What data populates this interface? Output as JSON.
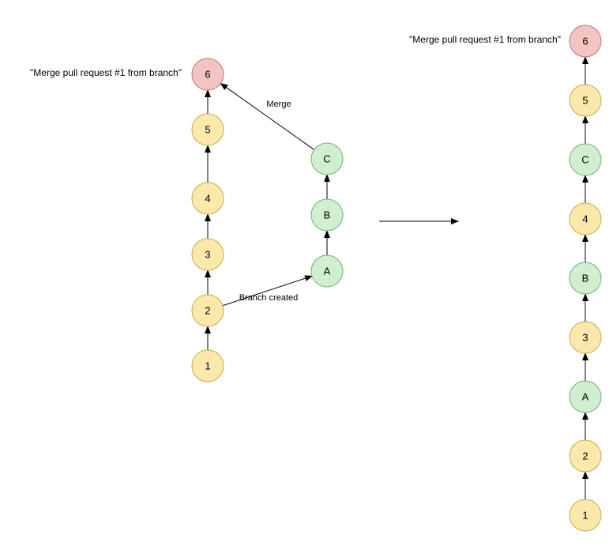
{
  "colors": {
    "yellow_fill": "#fae9ab",
    "yellow_stroke": "#c9a94a",
    "green_fill": "#d1eed1",
    "green_stroke": "#6fb36f",
    "red_fill": "#f2c4c2",
    "red_stroke": "#c27572",
    "arrow": "#000000"
  },
  "left": {
    "caption": "\"Merge pull request #1 from branch\"",
    "main": [
      {
        "label": "1",
        "color": "yellow"
      },
      {
        "label": "2",
        "color": "yellow"
      },
      {
        "label": "3",
        "color": "yellow"
      },
      {
        "label": "4",
        "color": "yellow"
      },
      {
        "label": "5",
        "color": "yellow"
      },
      {
        "label": "6",
        "color": "red"
      }
    ],
    "branch": [
      {
        "label": "A",
        "color": "green"
      },
      {
        "label": "B",
        "color": "green"
      },
      {
        "label": "C",
        "color": "green"
      }
    ],
    "edge_branch_created": "Branch created",
    "edge_merge": "Merge"
  },
  "right": {
    "caption": "\"Merge pull request #1 from branch\"",
    "sequence": [
      {
        "label": "1",
        "color": "yellow"
      },
      {
        "label": "2",
        "color": "yellow"
      },
      {
        "label": "A",
        "color": "green"
      },
      {
        "label": "3",
        "color": "yellow"
      },
      {
        "label": "B",
        "color": "green"
      },
      {
        "label": "4",
        "color": "yellow"
      },
      {
        "label": "C",
        "color": "green"
      },
      {
        "label": "5",
        "color": "yellow"
      },
      {
        "label": "6",
        "color": "red"
      }
    ]
  },
  "chart_data": {
    "type": "diagram",
    "description": "Git branch merge diagram showing before (branched) and after (linearized) commit histories",
    "left_graph": {
      "main_chain": [
        "1",
        "2",
        "3",
        "4",
        "5",
        "6"
      ],
      "branch_chain": [
        "A",
        "B",
        "C"
      ],
      "edges": [
        [
          "1",
          "2"
        ],
        [
          "2",
          "3"
        ],
        [
          "3",
          "4"
        ],
        [
          "4",
          "5"
        ],
        [
          "5",
          "6"
        ],
        [
          "2",
          "A"
        ],
        [
          "A",
          "B"
        ],
        [
          "B",
          "C"
        ],
        [
          "C",
          "6"
        ]
      ],
      "edge_labels": {
        "2-A": "Branch created",
        "C-6": "Merge"
      },
      "merge_commit": "6",
      "caption": "\"Merge pull request #1 from branch\""
    },
    "right_graph": {
      "linear_chain": [
        "1",
        "2",
        "A",
        "3",
        "B",
        "4",
        "C",
        "5",
        "6"
      ],
      "merge_commit": "6",
      "caption": "\"Merge pull request #1 from branch\""
    }
  }
}
